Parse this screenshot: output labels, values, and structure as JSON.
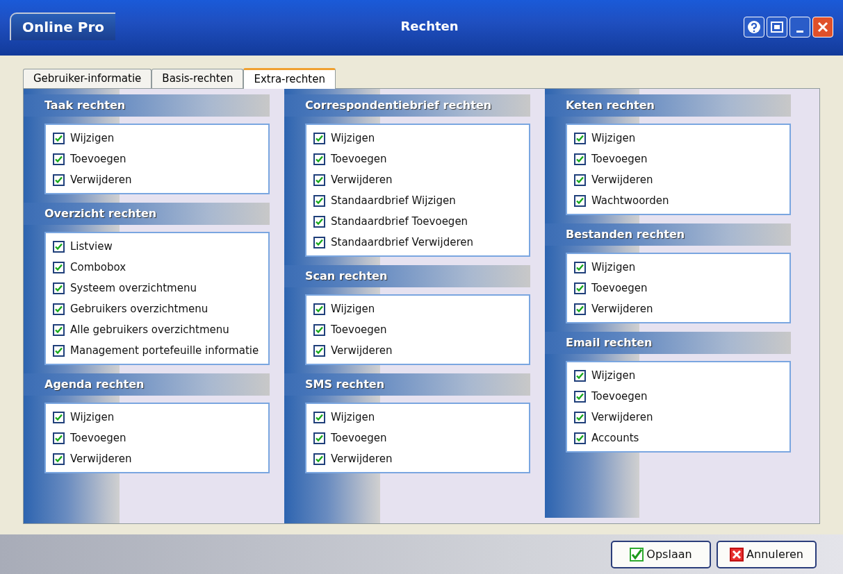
{
  "window": {
    "app_name": "Online Pro",
    "title": "Rechten"
  },
  "tabs": [
    {
      "label": "Gebruiker-informatie",
      "selected": false
    },
    {
      "label": "Basis-rechten",
      "selected": false
    },
    {
      "label": "Extra-rechten",
      "selected": true
    }
  ],
  "columns": [
    {
      "sections": [
        {
          "title": "Taak rechten",
          "items": [
            {
              "label": "Wijzigen",
              "checked": true
            },
            {
              "label": "Toevoegen",
              "checked": true
            },
            {
              "label": "Verwijderen",
              "checked": true
            }
          ]
        },
        {
          "title": "Overzicht rechten",
          "items": [
            {
              "label": "Listview",
              "checked": true
            },
            {
              "label": "Combobox",
              "checked": true
            },
            {
              "label": "Systeem overzichtmenu",
              "checked": true
            },
            {
              "label": "Gebruikers overzichtmenu",
              "checked": true
            },
            {
              "label": "Alle gebruikers overzichtmenu",
              "checked": true
            },
            {
              "label": "Management portefeuille informatie",
              "checked": true
            }
          ]
        },
        {
          "title": "Agenda rechten",
          "items": [
            {
              "label": "Wijzigen",
              "checked": true
            },
            {
              "label": "Toevoegen",
              "checked": true
            },
            {
              "label": "Verwijderen",
              "checked": true
            }
          ]
        }
      ]
    },
    {
      "sections": [
        {
          "title": "Correspondentiebrief rechten",
          "items": [
            {
              "label": "Wijzigen",
              "checked": true
            },
            {
              "label": "Toevoegen",
              "checked": true
            },
            {
              "label": "Verwijderen",
              "checked": true
            },
            {
              "label": "Standaardbrief Wijzigen",
              "checked": true
            },
            {
              "label": "Standaardbrief Toevoegen",
              "checked": true
            },
            {
              "label": "Standaardbrief Verwijderen",
              "checked": true
            }
          ]
        },
        {
          "title": "Scan rechten",
          "items": [
            {
              "label": "Wijzigen",
              "checked": true
            },
            {
              "label": "Toevoegen",
              "checked": true
            },
            {
              "label": "Verwijderen",
              "checked": true
            }
          ]
        },
        {
          "title": "SMS rechten",
          "items": [
            {
              "label": "Wijzigen",
              "checked": true
            },
            {
              "label": "Toevoegen",
              "checked": true
            },
            {
              "label": "Verwijderen",
              "checked": true
            }
          ]
        }
      ]
    },
    {
      "sections": [
        {
          "title": "Keten rechten",
          "items": [
            {
              "label": "Wijzigen",
              "checked": true
            },
            {
              "label": "Toevoegen",
              "checked": true
            },
            {
              "label": "Verwijderen",
              "checked": true
            },
            {
              "label": "Wachtwoorden",
              "checked": true
            }
          ]
        },
        {
          "title": "Bestanden rechten",
          "items": [
            {
              "label": "Wijzigen",
              "checked": true
            },
            {
              "label": "Toevoegen",
              "checked": true
            },
            {
              "label": "Verwijderen",
              "checked": true
            }
          ]
        },
        {
          "title": "Email rechten",
          "items": [
            {
              "label": "Wijzigen",
              "checked": true
            },
            {
              "label": "Toevoegen",
              "checked": true
            },
            {
              "label": "Verwijderen",
              "checked": true
            },
            {
              "label": "Accounts",
              "checked": true
            }
          ]
        }
      ]
    }
  ],
  "buttons": [
    {
      "label": "Opslaan",
      "kind": "save"
    },
    {
      "label": "Annuleren",
      "kind": "cancel"
    }
  ]
}
